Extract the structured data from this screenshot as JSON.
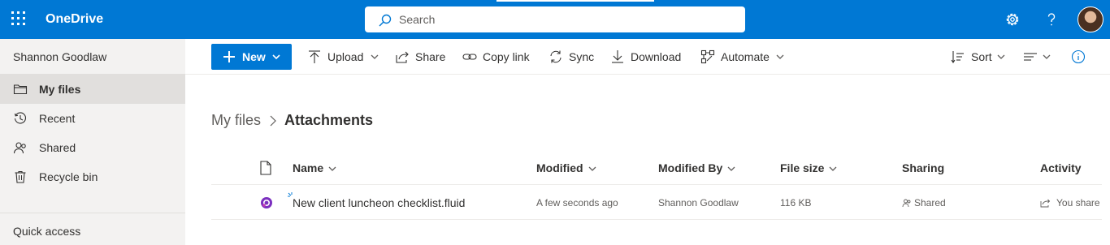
{
  "app": {
    "name": "OneDrive"
  },
  "search": {
    "placeholder": "Search"
  },
  "sidebar": {
    "user_name": "Shannon Goodlaw",
    "items": [
      {
        "label": "My files",
        "icon": "folder-icon",
        "selected": true
      },
      {
        "label": "Recent",
        "icon": "history-icon",
        "selected": false
      },
      {
        "label": "Shared",
        "icon": "people-icon",
        "selected": false
      },
      {
        "label": "Recycle bin",
        "icon": "recycle-bin-icon",
        "selected": false
      }
    ],
    "quick_access": "Quick access"
  },
  "commandbar": {
    "new": "New",
    "upload": "Upload",
    "share": "Share",
    "copy_link": "Copy link",
    "sync": "Sync",
    "download": "Download",
    "automate": "Automate",
    "sort": "Sort"
  },
  "breadcrumb": {
    "root": "My files",
    "current": "Attachments"
  },
  "list": {
    "columns": {
      "name": "Name",
      "modified": "Modified",
      "modified_by": "Modified By",
      "file_size": "File size",
      "sharing": "Sharing",
      "activity": "Activity"
    },
    "rows": [
      {
        "name": "New client luncheon checklist.fluid",
        "modified": "A few seconds ago",
        "modified_by": "Shannon Goodlaw",
        "file_size": "116 KB",
        "sharing": "Shared",
        "activity": "You share"
      }
    ]
  },
  "colors": {
    "brand": "#0078d4",
    "nav_background": "#f3f2f1",
    "nav_selected": "#e1dfdd",
    "fluid_icon": "#7b2fbf"
  }
}
